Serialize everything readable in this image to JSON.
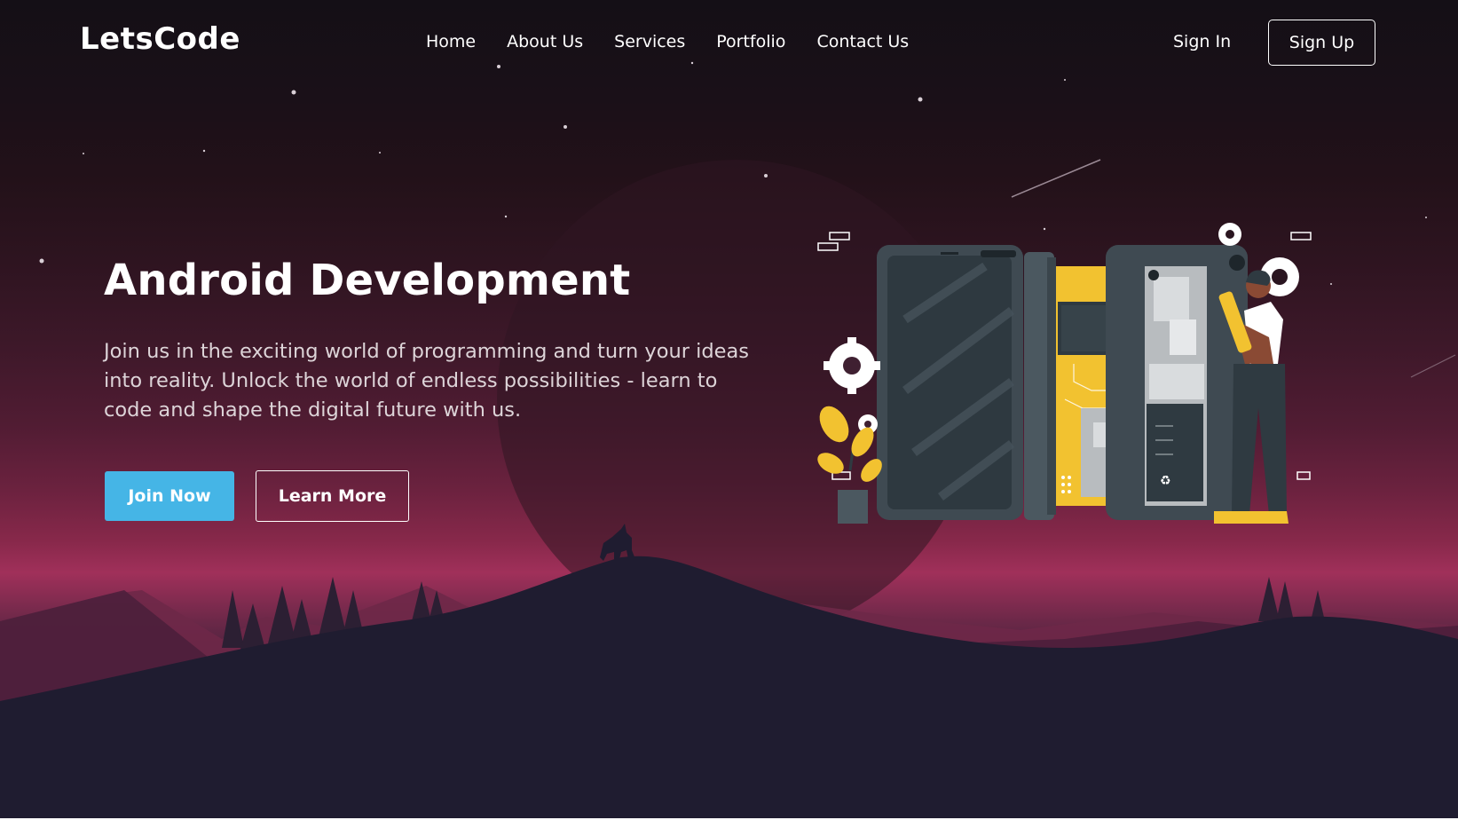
{
  "brand": {
    "logo": "LetsCode"
  },
  "nav": {
    "items": [
      {
        "label": "Home"
      },
      {
        "label": "About Us"
      },
      {
        "label": "Services"
      },
      {
        "label": "Portfolio"
      },
      {
        "label": "Contact Us"
      }
    ],
    "sign_in": "Sign In",
    "sign_up": "Sign Up"
  },
  "hero": {
    "title": "Android Development",
    "description": "Join us in the exciting world of programming and turn your ideas into reality. Unlock the world of endless possibilities - learn to code and shape the digital future with us.",
    "primary_button": "Join Now",
    "secondary_button": "Learn More"
  },
  "icons": {
    "gear": "gear-icon",
    "recycle": "recycle-icon",
    "star": "star-icon"
  },
  "colors": {
    "accent": "#45b5e6",
    "yellow": "#f2c230",
    "phone_dark": "#3f4a52",
    "text": "#ffffff"
  }
}
